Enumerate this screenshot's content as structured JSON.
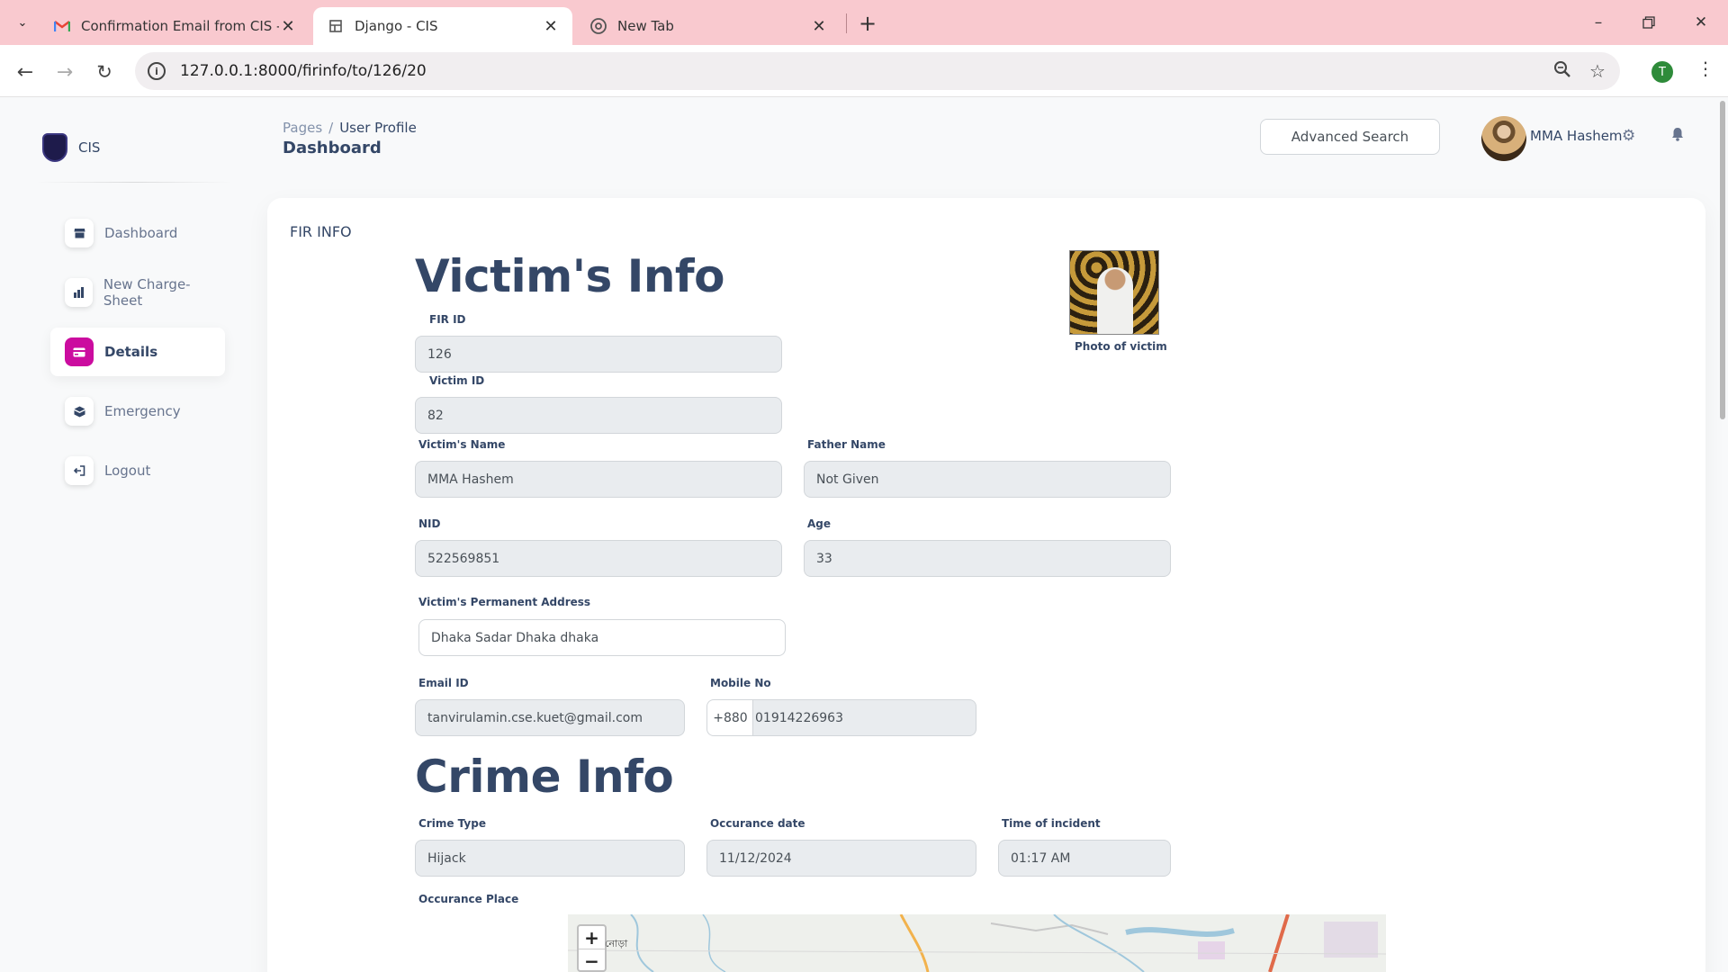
{
  "browser": {
    "tabs": [
      {
        "title": "Confirmation Email from CIS - t",
        "icon": "gmail-icon"
      },
      {
        "title": "Django - CIS",
        "icon": "django-icon"
      },
      {
        "title": "New Tab",
        "icon": "chrome-icon"
      }
    ],
    "url": "127.0.0.1:8000/firinfo/to/126/20",
    "profile_initial": "T"
  },
  "sidebar": {
    "brand": "CIS",
    "items": [
      {
        "label": "Dashboard",
        "icon": "shop-icon"
      },
      {
        "label": "New Charge-Sheet",
        "icon": "chart-icon"
      },
      {
        "label": "Details",
        "icon": "credit-card-icon"
      },
      {
        "label": "Emergency",
        "icon": "box-icon"
      },
      {
        "label": "Logout",
        "icon": "logout-icon"
      }
    ],
    "active_item": "Details",
    "accent_color": "#cb0c9f"
  },
  "header": {
    "breadcrumb": {
      "root": "Pages",
      "separator": "/",
      "current": "User Profile"
    },
    "title": "Dashboard",
    "advanced_search": "Advanced Search",
    "user_name": "MMA Hashem"
  },
  "card": {
    "title": "FIR INFO",
    "victim_heading": "Victim's Info",
    "photo_caption": "Photo of victim",
    "fields": {
      "fir_id": {
        "label": "FIR ID",
        "value": "126"
      },
      "victim_id": {
        "label": "Victim ID",
        "value": "82"
      },
      "victim_name": {
        "label": "Victim's Name",
        "value": "MMA Hashem"
      },
      "father_name": {
        "label": "Father Name",
        "value": "Not Given"
      },
      "nid": {
        "label": "NID",
        "value": "522569851"
      },
      "age": {
        "label": "Age",
        "value": "33"
      },
      "permanent_address": {
        "label": "Victim's Permanent Address",
        "value": "Dhaka Sadar Dhaka dhaka"
      },
      "email": {
        "label": "Email ID",
        "value": "tanvirulamin.cse.kuet@gmail.com"
      },
      "mobile": {
        "label": "Mobile No",
        "prefix": "+880",
        "value": "01914226963"
      }
    },
    "crime_heading": "Crime Info",
    "crime_fields": {
      "crime_type": {
        "label": "Crime Type",
        "value": "Hijack"
      },
      "occurance_date": {
        "label": "Occurance date",
        "value": "11/12/2024"
      },
      "time_of_incident": {
        "label": "Time of incident",
        "value": "01:17 AM"
      },
      "occurance_place": {
        "label": "Occurance Place"
      }
    },
    "map": {
      "zoom_in": "+",
      "zoom_out": "−",
      "place_label": "নোড়া"
    }
  }
}
